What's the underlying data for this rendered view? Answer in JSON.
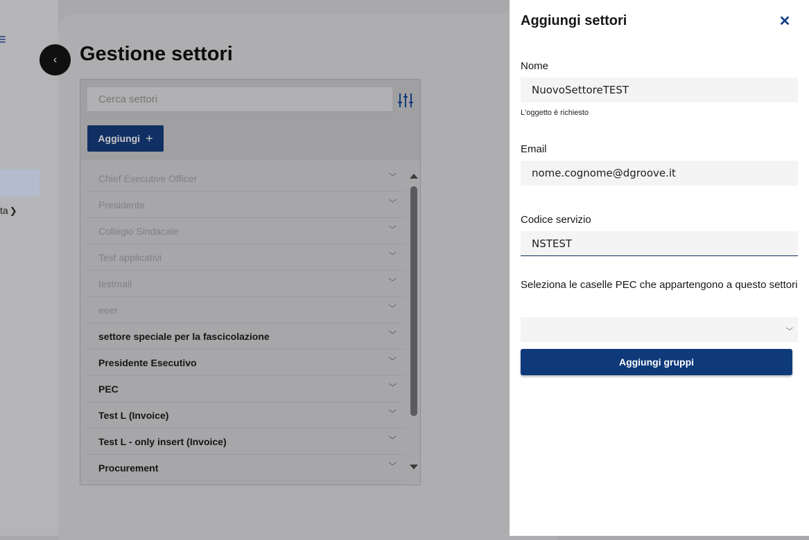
{
  "sidebar": {
    "logo_fragment": "≡",
    "nav_fragment": "ta"
  },
  "main": {
    "title": "Gestione settori",
    "search_placeholder": "Cerca settori",
    "add_button_label": "Aggiungi",
    "sectors": [
      {
        "label": "Chief Executive Officer",
        "disabled": true
      },
      {
        "label": "Presidente",
        "disabled": true
      },
      {
        "label": "Collegio Sindacale",
        "disabled": true
      },
      {
        "label": "Test applicativi",
        "disabled": true
      },
      {
        "label": "testmail",
        "disabled": true
      },
      {
        "label": "eeer",
        "disabled": true
      },
      {
        "label": "settore speciale per la fascicolazione",
        "disabled": false
      },
      {
        "label": "Presidente Esecutivo",
        "disabled": false
      },
      {
        "label": "PEC",
        "disabled": false
      },
      {
        "label": "Test L (Invoice)",
        "disabled": false
      },
      {
        "label": "Test L - only insert (Invoice)",
        "disabled": false
      },
      {
        "label": "Procurement",
        "disabled": false
      }
    ]
  },
  "drawer": {
    "title": "Aggiungi settori",
    "close_icon": "close-icon",
    "name_label": "Nome",
    "name_value": "NuovoSettoreTEST",
    "name_helper": "L'oggetto è richiesto",
    "email_label": "Email",
    "email_value": "nome.cognome@dgroove.it",
    "service_code_label": "Codice servizio",
    "service_code_value": "NSTEST",
    "pec_label": "Seleziona le caselle PEC che appartengono a questo settori",
    "pec_selected": "",
    "add_groups_label": "Aggiungi gruppi"
  },
  "colors": {
    "primary": "#0e3a7a",
    "overlay": "#a9a9ab"
  }
}
